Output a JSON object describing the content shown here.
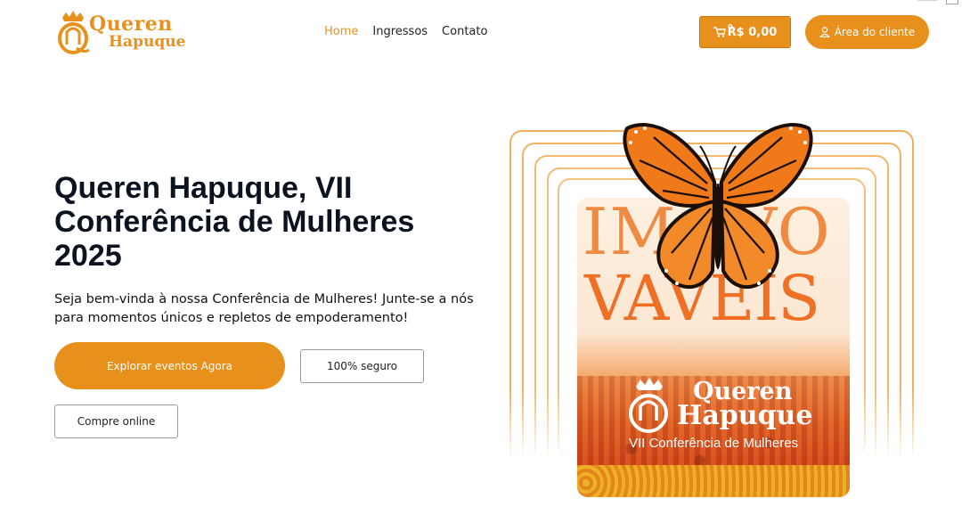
{
  "brand": {
    "line1": "Queren",
    "line2": "Hapuque",
    "accent_color": "#e8901c"
  },
  "nav": {
    "items": [
      {
        "label": "Home",
        "active": true
      },
      {
        "label": "Ingressos",
        "active": false
      },
      {
        "label": "Contato",
        "active": false
      }
    ]
  },
  "cart": {
    "count": "0",
    "total": "R$ 0,00",
    "icon": "cart-icon"
  },
  "client_area": {
    "label": "Área do cliente",
    "icon": "user-icon"
  },
  "hero": {
    "title": "Queren Hapuque, VII Conferência de Mulheres 2025",
    "subtitle": "Seja bem-vinda à nossa Conferência de Mulheres! Junte-se a nós para momentos únicos e repletos de empoderamento!",
    "cta_primary": "Explorar eventos Agora",
    "badge_secure": "100% seguro",
    "badge_buy": "Compre online"
  },
  "poster": {
    "word1": "IMOVO",
    "word2": "VAVEIS",
    "logo_line1": "Queren",
    "logo_line2": "Hapuque",
    "subtitle": "VII Conferência de Mulheres"
  }
}
